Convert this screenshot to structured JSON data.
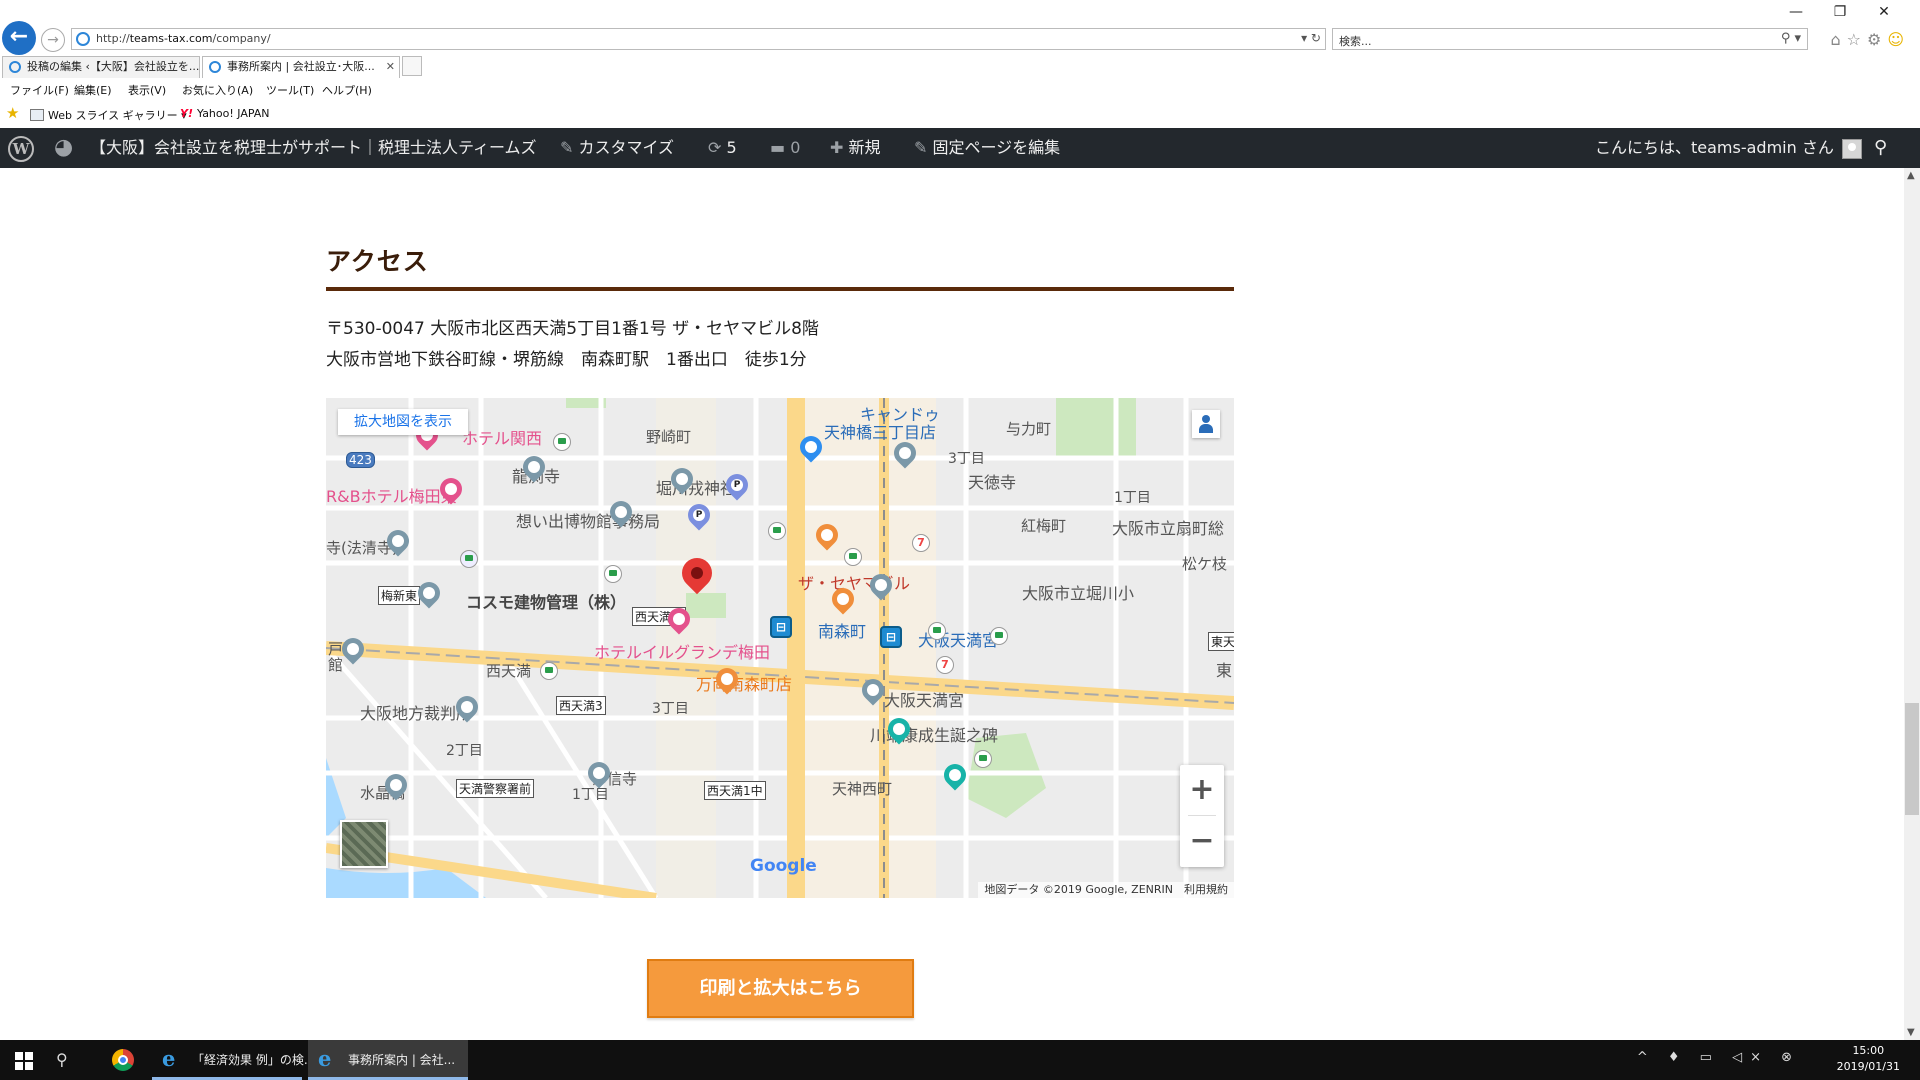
{
  "browser": {
    "url_prefix": "http://",
    "url_domain": "teams-tax.com",
    "url_path": "/company/",
    "addr_controls": "▾ ↻",
    "search_placeholder": "検索...",
    "search_controls": "⚲ ▾",
    "window_controls": [
      "—",
      "❐",
      "✕"
    ],
    "tabs": [
      {
        "label": "投稿の編集 ‹【大阪】会社設立を...",
        "active": false
      },
      {
        "label": "事務所案内 | 会社設立･大阪...",
        "active": true
      }
    ],
    "tab_close": "✕",
    "menu": [
      "ファイル(F)",
      "編集(E)",
      "表示(V)",
      "お気に入り(A)",
      "ツール(T)",
      "ヘルプ(H)"
    ],
    "favorites": [
      {
        "label": "Web スライス ギャラリー ▾"
      },
      {
        "label": "Yahoo! JAPAN",
        "mark": "Y!"
      }
    ]
  },
  "wp_admin_bar": {
    "site_title": "【大阪】会社設立を税理士がサポート｜税理士法人ティームズ",
    "customize": "カスタマイズ",
    "updates_count": "5",
    "comments_count": "0",
    "new": "新規",
    "edit_page": "固定ページを編集",
    "greeting": "こんにちは、teams-admin さん"
  },
  "content": {
    "section_title": "アクセス",
    "address_line1": "〒530-0047 大阪市北区西天満5丁目1番1号 ザ・セヤマビル8階",
    "address_line2": "大阪市営地下鉄谷町線・堺筋線　南森町駅　1番出口　徒歩1分",
    "print_button": "印刷と拡大はこちら"
  },
  "map": {
    "larger_map_link": "拡大地図を表示",
    "target_name": "ザ・セヤマビル",
    "labels": {
      "hotel_kansai": "ホテル関西",
      "nozaki": "野崎町",
      "kyandou": "キャンドゥ",
      "tenjinbashi_store": "天神橋三丁目店",
      "yoriki": "与力町",
      "sanchome_a": "3丁目",
      "tentokuji": "天徳寺",
      "icchome_a": "1丁目",
      "ryuenji": "龍渕寺",
      "horikawa_ebisu": "堀川戎神社",
      "rb_hotel": "R&Bホテル梅田東",
      "omoide": "想い出博物館事務局",
      "koubaicho": "紅梅町",
      "ougimachi": "大阪市立扇町総",
      "houseiji": "寺(法清寺)",
      "matsugae": "松ケ枝",
      "cosmo": "コスモ建物管理（株）",
      "horikawa_school": "大阪市立堀川小",
      "minamimorimachi": "南森町",
      "tenmangu_station": "大阪天満宮",
      "hotel_il_grande": "ホテルイルグランデ梅田",
      "nishitenma": "西天満",
      "manryo": "万両南森町店",
      "tenmangu": "大阪天満宮",
      "higashi": "東",
      "chihou_saiban": "大阪地方裁判所",
      "sanchome_b": "3丁目",
      "kawabata": "川端康成生誕之碑",
      "nichome": "2丁目",
      "joshinji": "浄信寺",
      "tenjin_nishi": "天神西町",
      "mizushobashi": "水晶橋",
      "icchome_b": "1丁目",
      "to": "戸",
      "kan": "館"
    },
    "road_signs": {
      "umeshinhigashi": "梅新東",
      "nishitenma_higashi": "西天満東",
      "nishitenma3": "西天満3",
      "tenma_keisatsu": "天満警察署前",
      "nishitenma1": "西天満1中",
      "higashiten": "東天",
      "route423": "423"
    },
    "zoom_in": "+",
    "zoom_out": "−",
    "google_logo": "Google",
    "attribution": "地図データ ©2019 Google, ZENRIN　利用規約"
  },
  "taskbar": {
    "apps": [
      {
        "label": "「経済効果 例」の検...",
        "active": false
      },
      {
        "label": "事務所案内 | 会社...",
        "active": true
      }
    ],
    "tray": "^ ♦ ▭ ◁× ⊗",
    "time": "15:00",
    "date": "2019/01/31"
  }
}
